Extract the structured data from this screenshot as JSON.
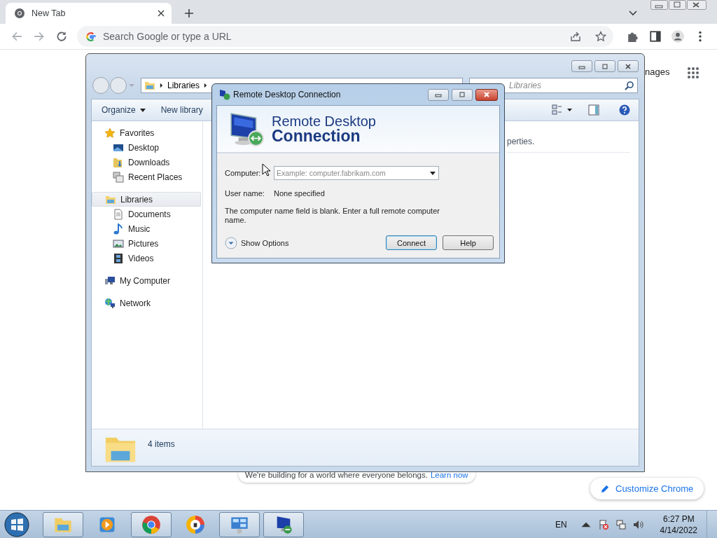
{
  "browser": {
    "tabs": [
      {
        "title": "New Tab",
        "selected": true
      }
    ],
    "omnibox": {
      "placeholder": "Search Google or type a URL"
    }
  },
  "newtab_page": {
    "top_link": "nages",
    "footer": {
      "text": "We're building for a world where everyone belongs.",
      "link": "Learn now"
    },
    "customize_button": "Customize Chrome"
  },
  "explorer": {
    "breadcrumb": [
      "Libraries"
    ],
    "search": {
      "placeholder": "Libraries"
    },
    "commands": [
      {
        "label": "Organize",
        "has_menu": true
      },
      {
        "label": "New library",
        "has_menu": false
      }
    ],
    "nav": [
      {
        "label": "Favorites",
        "selected": false,
        "children": [
          {
            "label": "Desktop",
            "selected": false
          },
          {
            "label": "Downloads",
            "selected": false
          },
          {
            "label": "Recent Places",
            "selected": false
          }
        ]
      },
      {
        "label": "Libraries",
        "selected": true,
        "children": [
          {
            "label": "Documents",
            "selected": false
          },
          {
            "label": "Music",
            "selected": false
          },
          {
            "label": "Pictures",
            "selected": false
          },
          {
            "label": "Videos",
            "selected": false
          }
        ]
      },
      {
        "label": "My Computer",
        "selected": false
      },
      {
        "label": "Network",
        "selected": false
      }
    ],
    "content_text": "perties.",
    "status": "4 items"
  },
  "dialog": {
    "title": "Remote Desktop Connection",
    "heading": {
      "line1": "Remote Desktop",
      "line2": "Connection"
    },
    "computer": {
      "label": "Computer:",
      "placeholder": "Example: computer.fabrikam.com"
    },
    "user": {
      "label": "User name:",
      "value": "None specified"
    },
    "message": "The computer name field is blank. Enter a full remote computer name.",
    "options_toggle": "Show Options",
    "buttons": [
      {
        "label": "Connect",
        "default": true
      },
      {
        "label": "Help",
        "default": false
      }
    ]
  },
  "taskbar": {
    "apps": [
      {
        "running": true
      },
      {
        "running": false
      },
      {
        "running": true
      },
      {
        "running": false
      },
      {
        "running": true
      },
      {
        "running": true
      }
    ],
    "language": "EN",
    "time": "6:27 PM",
    "date": "4/14/2022"
  }
}
